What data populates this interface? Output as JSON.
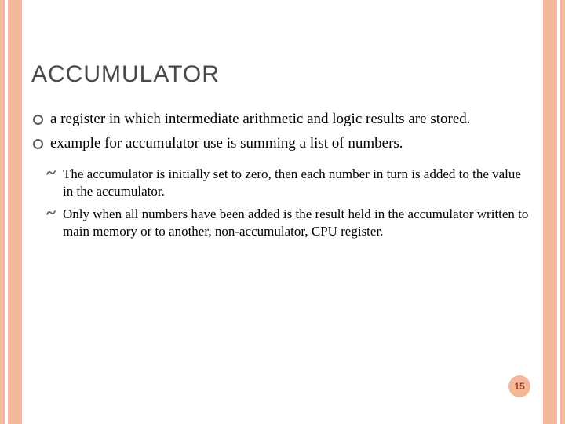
{
  "title": "ACCUMULATOR",
  "bullets": [
    "a register in which intermediate arithmetic and logic results are stored.",
    "example for accumulator use is summing a list of numbers."
  ],
  "sub_bullets": [
    "The accumulator is initially set to zero, then each number in turn is added to the value in the accumulator.",
    "Only when all numbers have been added is the result held in the accumulator written to main memory or to another, non-accumulator, CPU register."
  ],
  "page_number": "15"
}
